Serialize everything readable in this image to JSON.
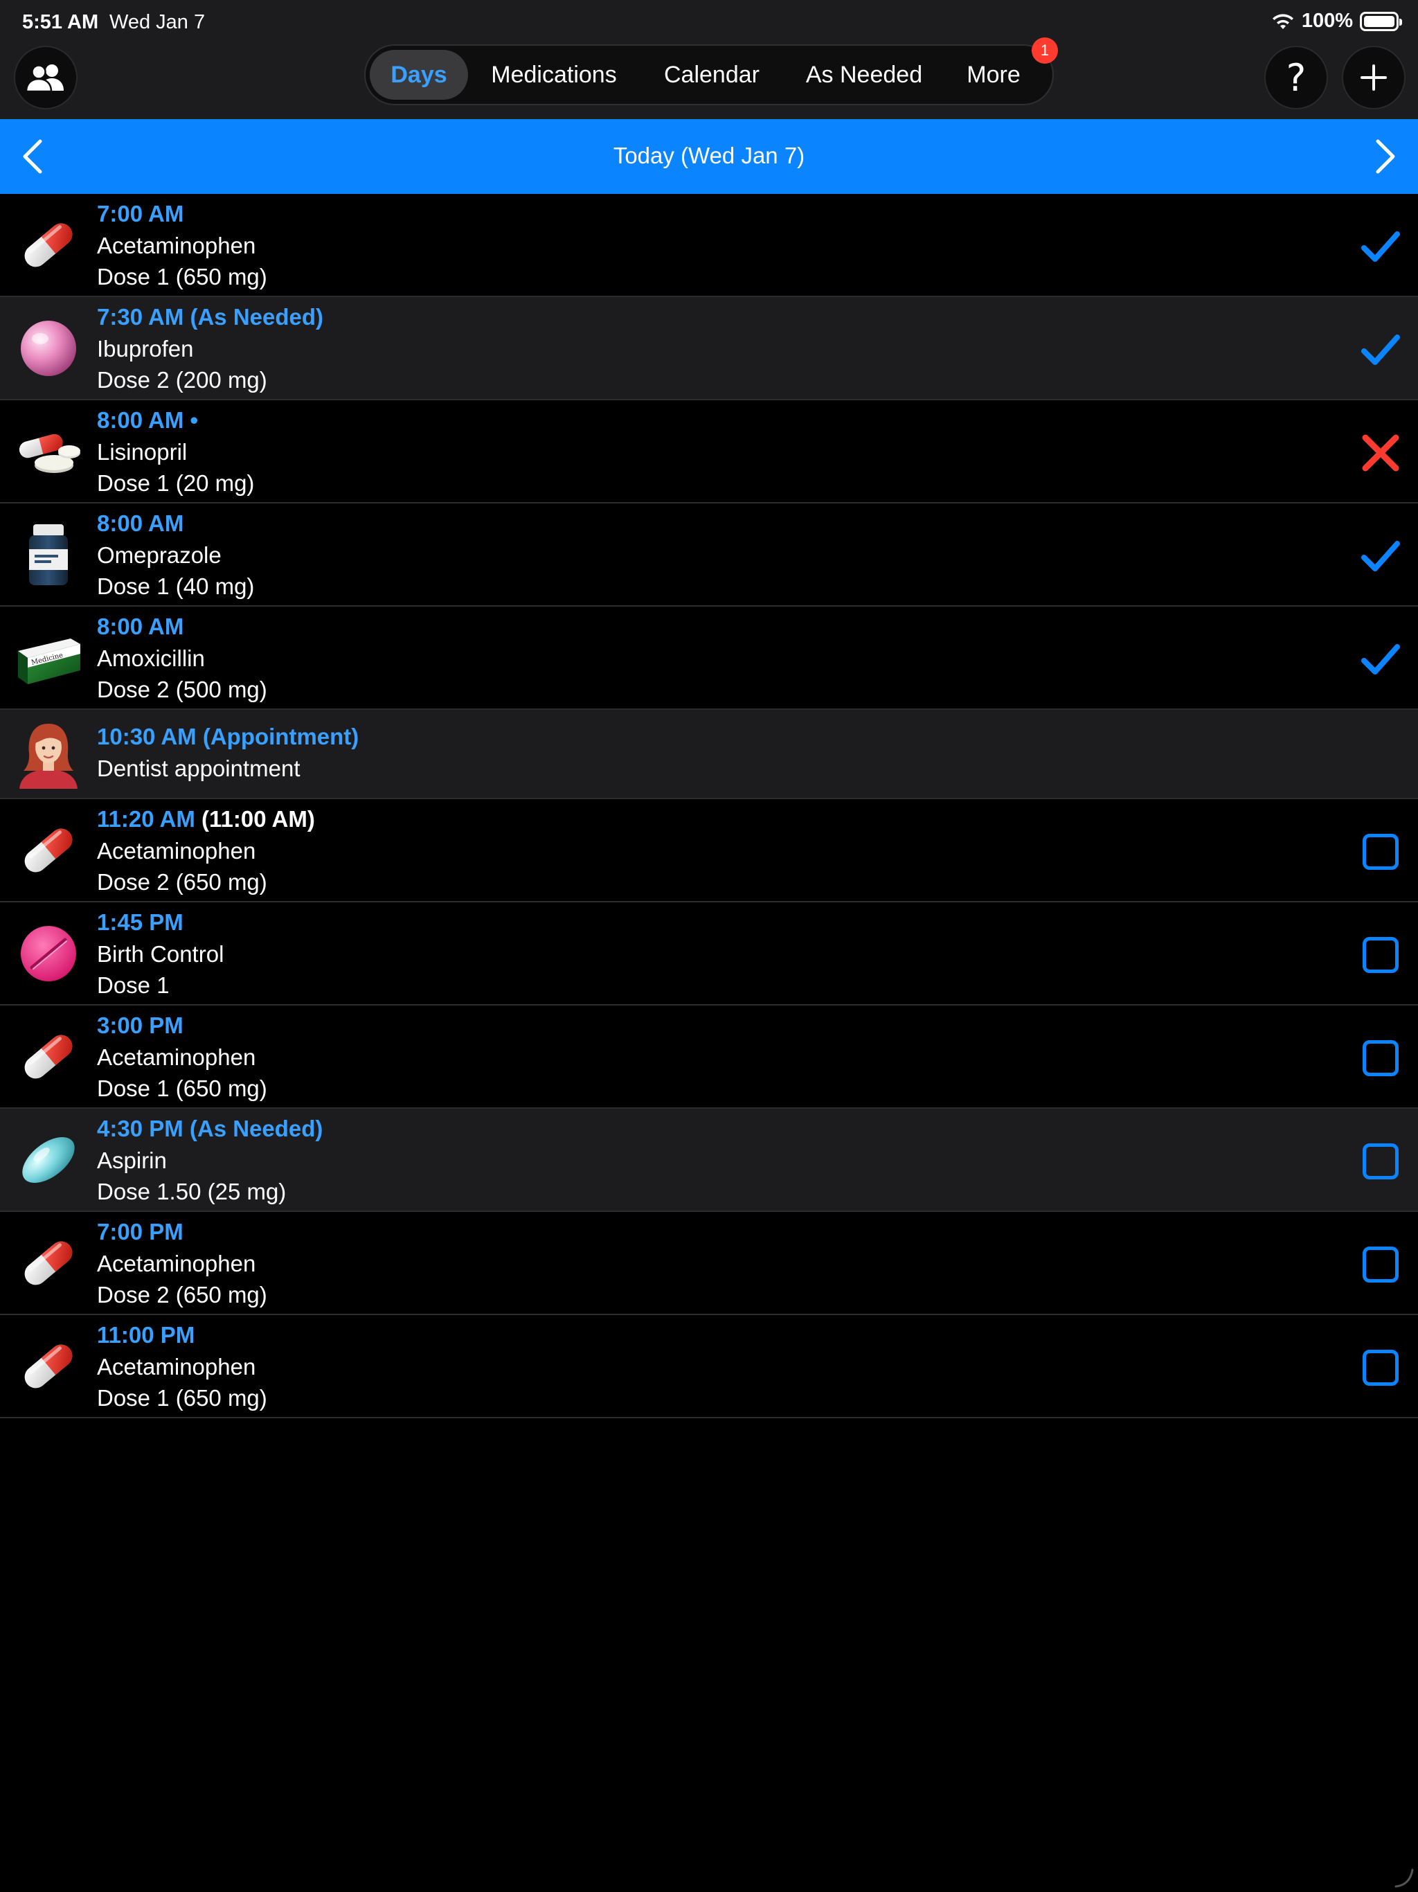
{
  "status_bar": {
    "time": "5:51 AM",
    "date": "Wed Jan 7",
    "battery": "100%",
    "battery_level": 1.0
  },
  "nav": {
    "tabs": [
      {
        "label": "Days",
        "active": true
      },
      {
        "label": "Medications",
        "active": false
      },
      {
        "label": "Calendar",
        "active": false
      },
      {
        "label": "As Needed",
        "active": false
      },
      {
        "label": "More",
        "active": false,
        "badge": "1"
      }
    ],
    "left_icon": "people-icon",
    "help_label": "?",
    "add_icon": "plus-icon"
  },
  "date_bar": {
    "title": "Today (Wed Jan 7)"
  },
  "colors": {
    "accent": "#0a84ff",
    "time_text": "#3aa0ff",
    "missed": "#ff3b30",
    "shaded_row": "#1c1c1e"
  },
  "entries": [
    {
      "time": "7:00 AM",
      "name": "Acetaminophen",
      "dose": "Dose 1 (650 mg)",
      "icon": "capsule-red-white-icon",
      "status": "taken",
      "shaded": false
    },
    {
      "time": "7:30 AM (As Needed)",
      "name": "Ibuprofen",
      "dose": "Dose 2 (200 mg)",
      "icon": "pink-pearl-pill-icon",
      "status": "taken",
      "shaded": true
    },
    {
      "time": "8:00 AM •",
      "name": "Lisinopril",
      "dose": "Dose 1 (20 mg)",
      "icon": "capsule-and-tablets-icon",
      "status": "missed",
      "shaded": false
    },
    {
      "time": "8:00 AM",
      "name": "Omeprazole",
      "dose": "Dose 1 (40 mg)",
      "icon": "pill-bottle-icon",
      "status": "taken",
      "shaded": false
    },
    {
      "time": "8:00 AM",
      "name": "Amoxicillin",
      "dose": "Dose 2 (500 mg)",
      "icon": "medicine-box-icon",
      "status": "taken",
      "shaded": false
    },
    {
      "time": "10:30 AM (Appointment)",
      "name": "Dentist appointment",
      "icon": "person-avatar-icon",
      "status": "none",
      "shaded": true,
      "appointment": true
    },
    {
      "time": "11:20 AM",
      "original_time": "(11:00 AM)",
      "name": "Acetaminophen",
      "dose": "Dose 2 (650 mg)",
      "icon": "capsule-red-white-icon",
      "status": "pending",
      "shaded": false
    },
    {
      "time": "1:45 PM",
      "name": "Birth Control",
      "dose": "Dose 1",
      "icon": "pink-round-tablet-icon",
      "status": "pending",
      "shaded": false
    },
    {
      "time": "3:00 PM",
      "name": "Acetaminophen",
      "dose": "Dose 1 (650 mg)",
      "icon": "capsule-red-white-icon",
      "status": "pending",
      "shaded": false
    },
    {
      "time": "4:30 PM (As Needed)",
      "name": "Aspirin",
      "dose": "Dose 1.50 (25 mg)",
      "icon": "teal-oval-pill-icon",
      "status": "pending",
      "shaded": true
    },
    {
      "time": "7:00 PM",
      "name": "Acetaminophen",
      "dose": "Dose 2 (650 mg)",
      "icon": "capsule-red-white-icon",
      "status": "pending",
      "shaded": false
    },
    {
      "time": "11:00 PM",
      "name": "Acetaminophen",
      "dose": "Dose 1 (650 mg)",
      "icon": "capsule-red-white-icon",
      "status": "pending",
      "shaded": false
    }
  ]
}
